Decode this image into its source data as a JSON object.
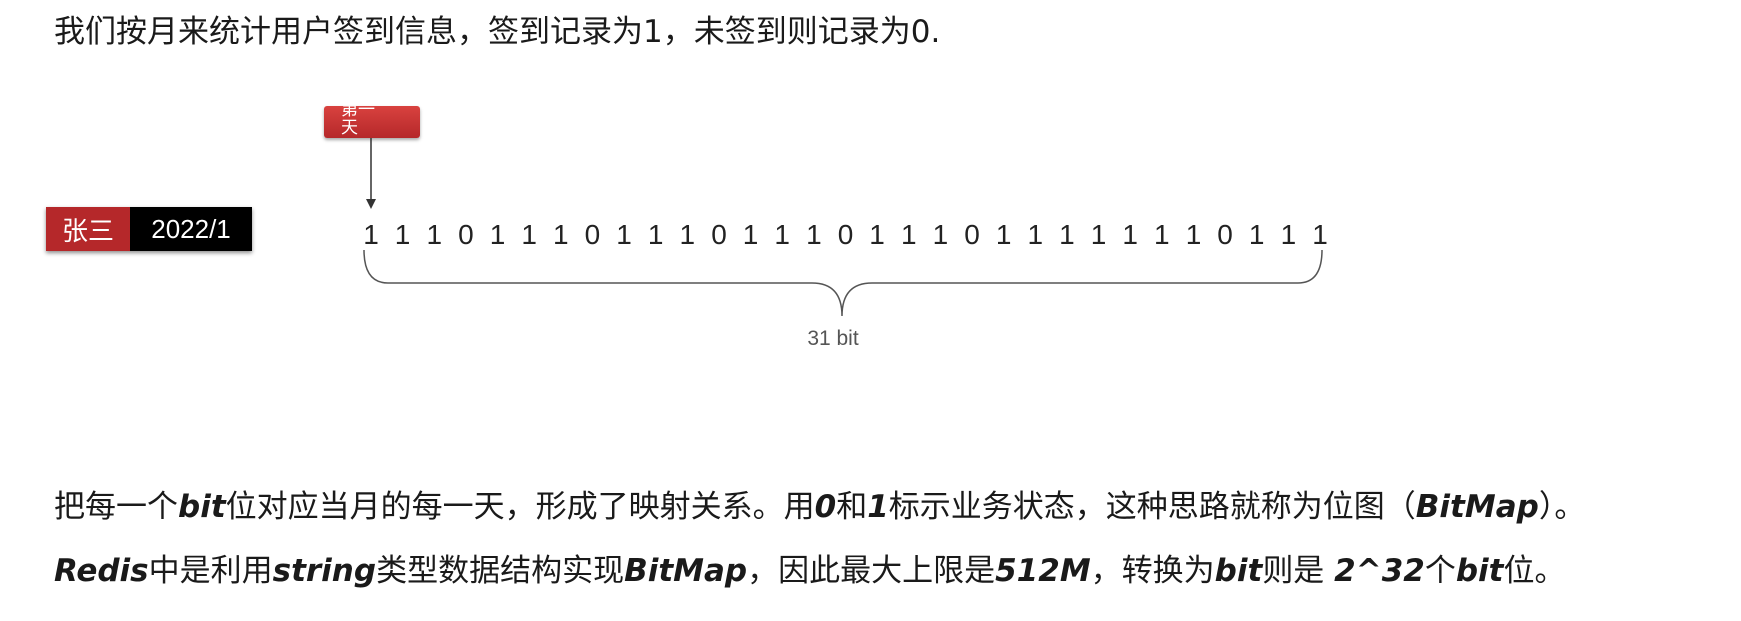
{
  "intro": "我们按月来统计用户签到信息，签到记录为1，未签到则记录为0.",
  "first_day_label": "第一天",
  "user": {
    "name": "张三",
    "month": "2022/1"
  },
  "bits": [
    1,
    1,
    1,
    0,
    1,
    1,
    1,
    0,
    1,
    1,
    1,
    0,
    1,
    1,
    1,
    0,
    1,
    1,
    1,
    0,
    1,
    1,
    1,
    1,
    1,
    1,
    1,
    0,
    1,
    1,
    1
  ],
  "brace_label": "31 bit",
  "paragraph1": {
    "p1": "把每一个",
    "bit": "bit",
    "p2": "位对应当月的每一天，形成了映射关系。用",
    "zero": "0",
    "p3": "和",
    "one": "1",
    "p4": "标示业务状态，这种思路就称为位图（",
    "bitmap": "BitMap",
    "p5": "）。"
  },
  "paragraph2": {
    "redis": "Redis",
    "p1": "中是利用",
    "string": "string",
    "p2": "类型数据结构实现",
    "bitmap": "BitMap",
    "p3": "，因此最大上限是",
    "size": "512M",
    "p4": "，转换为",
    "bit": "bit",
    "p5": "则是 ",
    "power": "2^32",
    "p6": "个",
    "bit2": "bit",
    "p7": "位。"
  }
}
